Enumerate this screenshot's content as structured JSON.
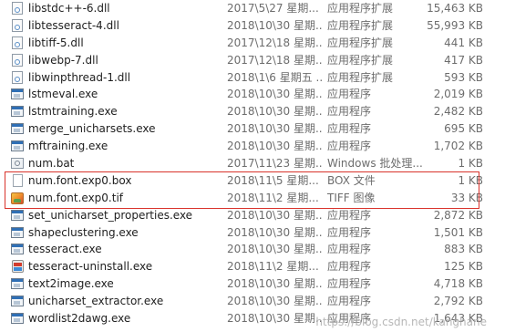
{
  "files": [
    {
      "name": "libstdc++-6.dll",
      "date": "2017\\5\\27 星期...",
      "type": "应用程序扩展",
      "size": "15,463 KB",
      "icon": "dll-file-icon"
    },
    {
      "name": "libtesseract-4.dll",
      "date": "2018\\10\\30 星期...",
      "type": "应用程序扩展",
      "size": "55,993 KB",
      "icon": "dll-file-icon"
    },
    {
      "name": "libtiff-5.dll",
      "date": "2017\\12\\18 星期...",
      "type": "应用程序扩展",
      "size": "441 KB",
      "icon": "dll-file-icon"
    },
    {
      "name": "libwebp-7.dll",
      "date": "2017\\12\\18 星期...",
      "type": "应用程序扩展",
      "size": "417 KB",
      "icon": "dll-file-icon"
    },
    {
      "name": "libwinpthread-1.dll",
      "date": "2018\\1\\6 星期五 ...",
      "type": "应用程序扩展",
      "size": "593 KB",
      "icon": "dll-file-icon"
    },
    {
      "name": "lstmeval.exe",
      "date": "2018\\10\\30 星期...",
      "type": "应用程序",
      "size": "2,019 KB",
      "icon": "exe-file-icon"
    },
    {
      "name": "lstmtraining.exe",
      "date": "2018\\10\\30 星期...",
      "type": "应用程序",
      "size": "2,482 KB",
      "icon": "exe-file-icon"
    },
    {
      "name": "merge_unicharsets.exe",
      "date": "2018\\10\\30 星期...",
      "type": "应用程序",
      "size": "695 KB",
      "icon": "exe-file-icon"
    },
    {
      "name": "mftraining.exe",
      "date": "2018\\10\\30 星期...",
      "type": "应用程序",
      "size": "1,702 KB",
      "icon": "exe-file-icon"
    },
    {
      "name": "num.bat",
      "date": "2017\\11\\23 星期...",
      "type": "Windows 批处理...",
      "size": "1 KB",
      "icon": "batch-file-icon"
    },
    {
      "name": "num.font.exp0.box",
      "date": "2018\\11\\5 星期...",
      "type": "BOX 文件",
      "size": "1 KB",
      "icon": "blank-file-icon"
    },
    {
      "name": "num.font.exp0.tif",
      "date": "2018\\11\\2 星期...",
      "type": "TIFF 图像",
      "size": "33 KB",
      "icon": "image-file-icon"
    },
    {
      "name": "set_unicharset_properties.exe",
      "date": "2018\\10\\30 星期...",
      "type": "应用程序",
      "size": "2,872 KB",
      "icon": "exe-file-icon"
    },
    {
      "name": "shapeclustering.exe",
      "date": "2018\\10\\30 星期...",
      "type": "应用程序",
      "size": "1,501 KB",
      "icon": "exe-file-icon"
    },
    {
      "name": "tesseract.exe",
      "date": "2018\\10\\30 星期...",
      "type": "应用程序",
      "size": "883 KB",
      "icon": "exe-file-icon"
    },
    {
      "name": "tesseract-uninstall.exe",
      "date": "2018\\11\\2 星期...",
      "type": "应用程序",
      "size": "125 KB",
      "icon": "uninstaller-icon"
    },
    {
      "name": "text2image.exe",
      "date": "2018\\10\\30 星期...",
      "type": "应用程序",
      "size": "4,718 KB",
      "icon": "exe-file-icon"
    },
    {
      "name": "unicharset_extractor.exe",
      "date": "2018\\10\\30 星期...",
      "type": "应用程序",
      "size": "2,792 KB",
      "icon": "exe-file-icon"
    },
    {
      "name": "wordlist2dawg.exe",
      "date": "2018\\10\\30 星期...",
      "type": "应用程序",
      "size": "1,643 KB",
      "icon": "exe-file-icon"
    }
  ],
  "watermark": "https://blog.csdn.net/kanghane",
  "colors": {
    "highlight_box": "#d9332b"
  }
}
